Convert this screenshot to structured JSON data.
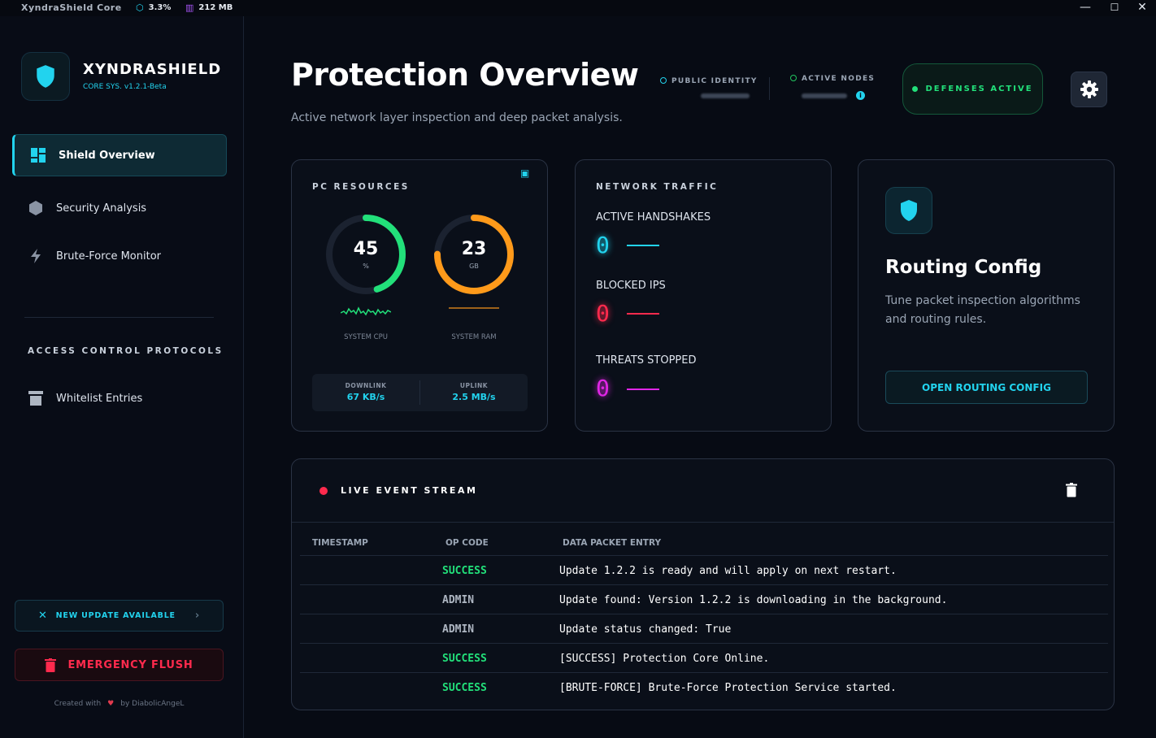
{
  "titlebar": {
    "app_title": "XyndraShield Core",
    "cpu": "3.3%",
    "memory": "212 MB",
    "controls": {
      "minimize": "—",
      "maximize": "☐",
      "close": "✕"
    }
  },
  "brand": {
    "name": "XYNDRASHIELD",
    "version": "CORE SYS. v1.2.1-Beta"
  },
  "nav": {
    "items": [
      {
        "label": "Shield Overview",
        "icon": "grid-icon",
        "active": true
      },
      {
        "label": "Security Analysis",
        "icon": "hexagon-icon",
        "active": false
      },
      {
        "label": "Brute-Force Monitor",
        "icon": "bolt-icon",
        "active": false
      }
    ],
    "section_title": "ACCESS CONTROL PROTOCOLS",
    "section_items": [
      {
        "label": "Whitelist Entries",
        "icon": "list-filter-icon"
      }
    ]
  },
  "sidebar_footer": {
    "update_label": "NEW UPDATE AVAILABLE",
    "flush_label": "EMERGENCY FLUSH",
    "credit_prefix": "Created with",
    "credit_suffix": "by DiabolicAngeL"
  },
  "header": {
    "title": "Protection Overview",
    "subtitle": "Active network layer inspection and deep packet analysis.",
    "public_identity_label": "PUBLIC IDENTITY",
    "active_nodes_label": "ACTIVE NODES",
    "status_label": "DEFENSES ACTIVE"
  },
  "resources": {
    "title": "PC RESOURCES",
    "cpu": {
      "value": "45",
      "unit": "%",
      "caption": "SYSTEM CPU",
      "percent": 45
    },
    "ram": {
      "value": "23",
      "unit": "GB",
      "caption": "SYSTEM RAM",
      "percent": 75
    },
    "downlink_label": "DOWNLINK",
    "downlink_value": "67 KB/s",
    "uplink_label": "UPLINK",
    "uplink_value": "2.5 MB/s"
  },
  "network": {
    "title": "NETWORK TRAFFIC",
    "stats": [
      {
        "label": "ACTIVE HANDSHAKES",
        "value": "0",
        "color": "#22d3ee"
      },
      {
        "label": "BLOCKED IPS",
        "value": "0",
        "color": "#ff2a4d"
      },
      {
        "label": "THREATS STOPPED",
        "value": "0",
        "color": "#e026e6"
      }
    ]
  },
  "routing": {
    "title": "Routing Config",
    "description": "Tune packet inspection algorithms and routing rules.",
    "button_label": "OPEN ROUTING CONFIG"
  },
  "events": {
    "title": "LIVE EVENT STREAM",
    "columns": [
      "TIMESTAMP",
      "OP CODE",
      "DATA PACKET ENTRY"
    ],
    "rows": [
      {
        "timestamp": "",
        "op": "SUCCESS",
        "msg": "Update 1.2.2 is ready and will apply on next restart."
      },
      {
        "timestamp": "",
        "op": "ADMIN",
        "msg": "Update found: Version 1.2.2 is downloading in the background."
      },
      {
        "timestamp": "",
        "op": "ADMIN",
        "msg": "Update status changed: True"
      },
      {
        "timestamp": "",
        "op": "SUCCESS",
        "msg": "[SUCCESS] Protection Core Online."
      },
      {
        "timestamp": "",
        "op": "SUCCESS",
        "msg": "[BRUTE-FORCE] Brute-Force Protection Service started."
      }
    ]
  },
  "colors": {
    "accent": "#22d3ee",
    "success": "#22e07a",
    "danger": "#ff2a4d",
    "admin": "#aeb6c2",
    "ram": "#ff9a1a",
    "threat": "#e026e6"
  }
}
